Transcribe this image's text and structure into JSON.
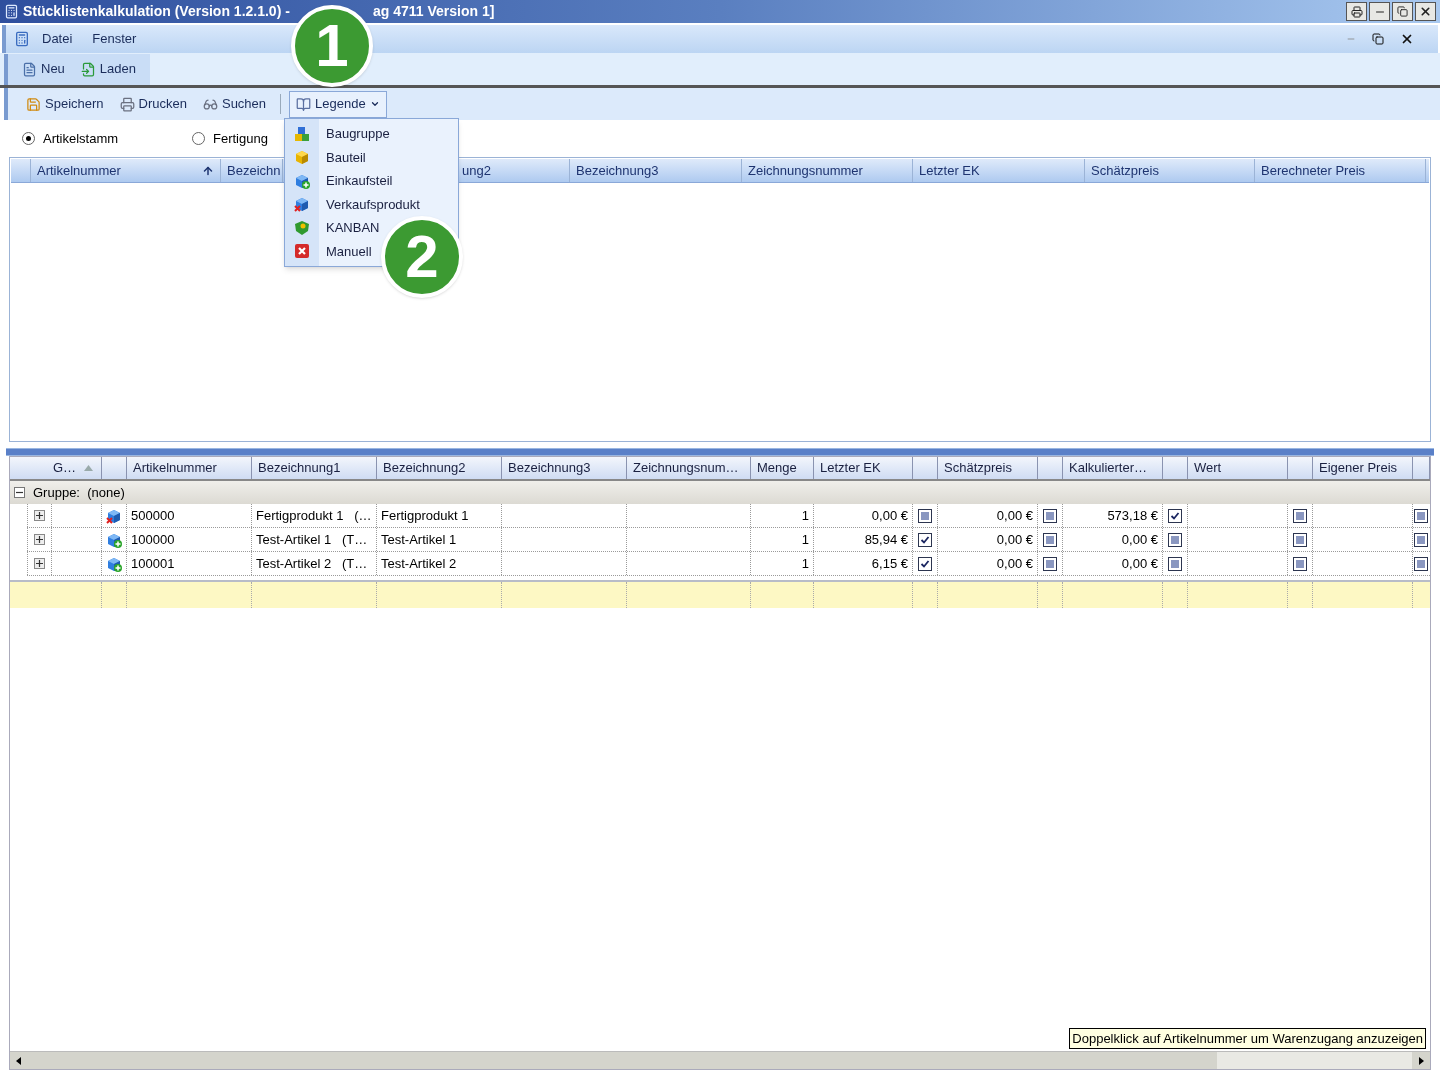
{
  "window": {
    "title_start": "Stücklistenkalkulation (Version 1.2.1.0) -",
    "title_end": "ag 4711 Version 1]"
  },
  "menu": [
    "Datei",
    "Fenster"
  ],
  "toolbar_1": [
    {
      "label": "Neu",
      "kind": "new"
    },
    {
      "label": "Laden",
      "kind": "load"
    }
  ],
  "toolbar_2": [
    {
      "label": "Speichern",
      "kind": "save"
    },
    {
      "label": "Drucken",
      "kind": "print"
    },
    {
      "label": "Suchen",
      "kind": "search"
    }
  ],
  "legend_button": {
    "label": "Legende",
    "expanded": true
  },
  "legend_menu": [
    {
      "label": "Baugruppe",
      "kind": "assembly"
    },
    {
      "label": "Bauteil",
      "kind": "part"
    },
    {
      "label": "Einkaufsteil",
      "kind": "purchased"
    },
    {
      "label": "Verkaufsprodukt",
      "kind": "sales"
    },
    {
      "label": "KANBAN",
      "kind": "kanban"
    },
    {
      "label": "Manuell",
      "kind": "manual"
    }
  ],
  "view_options": [
    {
      "label": "Artikelstamm",
      "selected": true
    },
    {
      "label": "Fertigung",
      "selected": false
    }
  ],
  "upper_grid": {
    "columns": [
      {
        "label": "Artikelnummer",
        "sort_ascending": true
      },
      {
        "label": "Bezeichn"
      },
      {
        "label": "ung2",
        "sort_ascending": false
      },
      {
        "label": "Bezeichnung3",
        "sort_ascending": false
      },
      {
        "label": "Zeichnungsnummer",
        "sort_ascending": false
      },
      {
        "label": "Letzter EK",
        "sort_ascending": false
      },
      {
        "label": "Schätzpreis",
        "sort_ascending": false
      },
      {
        "label": "Berechneter Preis",
        "sort_ascending": false
      }
    ]
  },
  "callouts": [
    "1",
    "2"
  ],
  "lower_grid": {
    "columns": [
      {
        "label": "G…",
        "sort_ascending": true
      },
      {
        "label": "Artikelnummer",
        "sort_ascending": false
      },
      {
        "label": "Bezeichnung1",
        "sort_ascending": false
      },
      {
        "label": "Bezeichnung2",
        "sort_ascending": false
      },
      {
        "label": "Bezeichnung3",
        "sort_ascending": false
      },
      {
        "label": "Zeichnungsnum…",
        "sort_ascending": false
      },
      {
        "label": "Menge",
        "sort_ascending": false
      },
      {
        "label": "Letzter EK",
        "sort_ascending": false
      },
      {
        "label": "Schätzpreis",
        "sort_ascending": false
      },
      {
        "label": "Kalkulierter…",
        "sort_ascending": false
      },
      {
        "label": "Wert",
        "sort_ascending": false
      },
      {
        "label": "Eigener Preis",
        "sort_ascending": false
      }
    ],
    "group": {
      "label": "Gruppe:",
      "value": "(none)",
      "expanded": true
    },
    "rows": [
      {
        "expanded": false,
        "kind": "sales",
        "article": "500000",
        "name1": "Fertigprodukt 1   (…",
        "name2": "Fertigprodukt 1",
        "quantity": "1",
        "last_price": "0,00 €",
        "last_price_checked": false,
        "estimate": "0,00 €",
        "estimate_checked": false,
        "calculated": "573,18 €",
        "calculated_checked": true,
        "value_checked": false,
        "own_price_checked": false
      },
      {
        "expanded": false,
        "kind": "purchased",
        "article": "100000",
        "name1": "Test-Artikel 1   (T…",
        "name2": "Test-Artikel 1",
        "quantity": "1",
        "last_price": "85,94 €",
        "last_price_checked": true,
        "estimate": "0,00 €",
        "estimate_checked": false,
        "calculated": "0,00 €",
        "calculated_checked": false,
        "value_checked": false,
        "own_price_checked": false
      },
      {
        "expanded": false,
        "kind": "purchased",
        "article": "100001",
        "name1": "Test-Artikel 2   (T…",
        "name2": "Test-Artikel 2",
        "quantity": "1",
        "last_price": "6,15 €",
        "last_price_checked": true,
        "estimate": "0,00 €",
        "estimate_checked": false,
        "calculated": "0,00 €",
        "calculated_checked": false,
        "value_checked": false,
        "own_price_checked": false
      }
    ]
  },
  "tooltip": "Doppelklick auf Artikelnummer um Warenzugang anzuzeigen"
}
